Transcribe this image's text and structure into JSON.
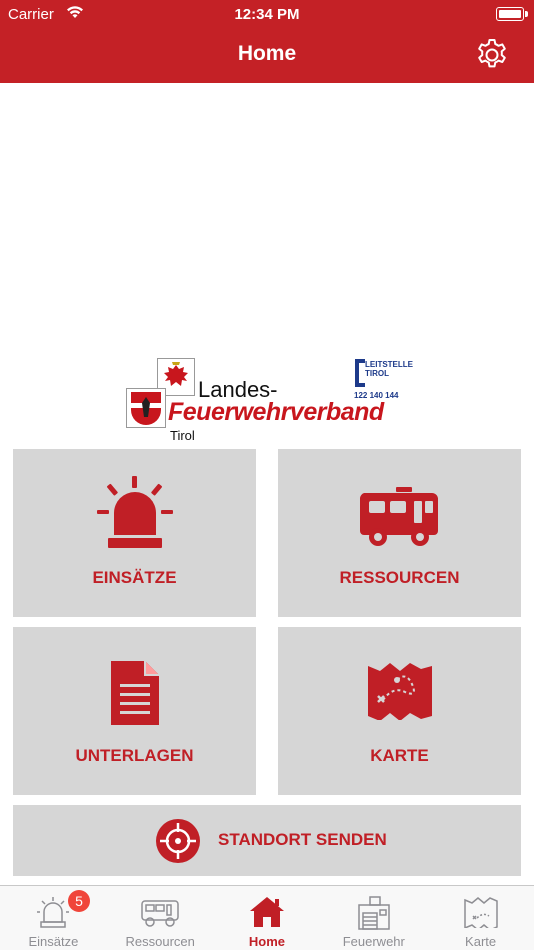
{
  "status_bar": {
    "carrier": "Carrier",
    "time": "12:34 PM"
  },
  "nav": {
    "title": "Home"
  },
  "logo": {
    "line1": "Landes-",
    "line2": "Feuerwehrverband",
    "line3": "Tirol",
    "leitstelle_line1": "LEITSTELLE",
    "leitstelle_line2": "TIROL",
    "leitstelle_numbers": "122 140 144"
  },
  "tiles": {
    "einsaetze": "EINSÄTZE",
    "ressourcen": "RESSOURCEN",
    "unterlagen": "UNTERLAGEN",
    "karte": "KARTE",
    "standort": "STANDORT SENDEN"
  },
  "tabbar": {
    "items": [
      {
        "label": "Einsätze",
        "icon": "siren-icon",
        "badge": "5"
      },
      {
        "label": "Ressourcen",
        "icon": "truck-icon"
      },
      {
        "label": "Home",
        "icon": "home-icon"
      },
      {
        "label": "Feuerwehr",
        "icon": "fire-station-icon"
      },
      {
        "label": "Karte",
        "icon": "map-icon"
      }
    ],
    "active": "Home"
  },
  "colors": {
    "brand_red": "#c42126",
    "tile_gray": "#d6d6d6",
    "badge_red": "#f0453a",
    "inactive_gray": "#8e8e93"
  }
}
